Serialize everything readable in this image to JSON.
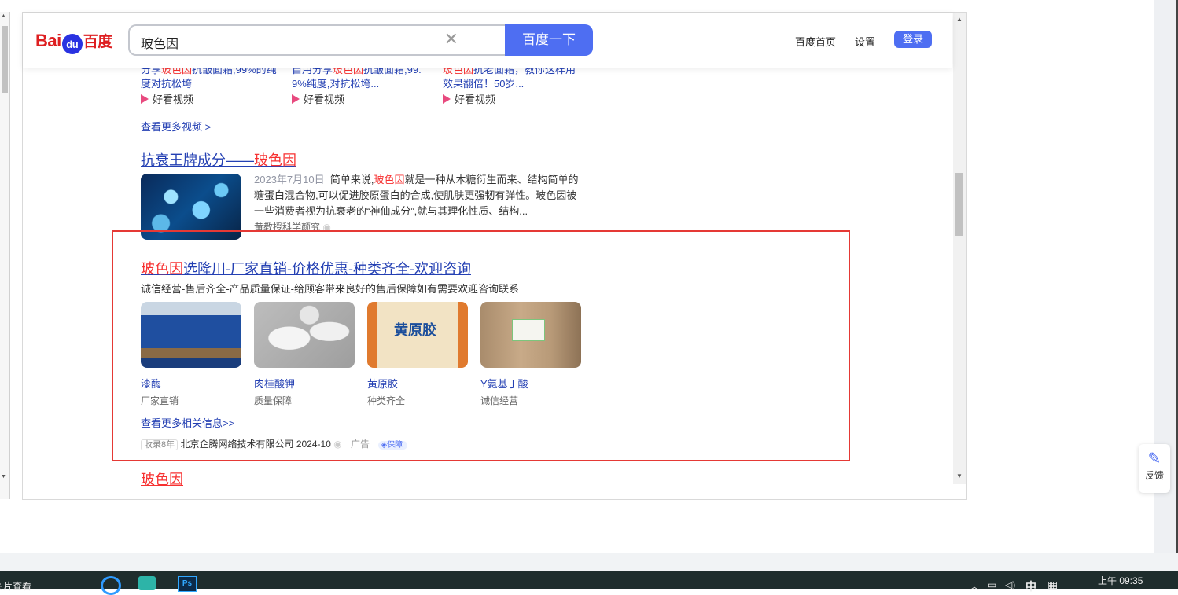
{
  "header": {
    "logo_latin": "Bai",
    "logo_paw": "du",
    "logo_cn": "百度",
    "query": "玻色因",
    "search_button": "百度一下",
    "nav_home": "百度首页",
    "nav_settings": "设置",
    "login": "登录"
  },
  "videos": [
    {
      "pre": "分享",
      "hl": "玻色因",
      "post": "抗皱面霜,99%的纯",
      "line2": "度对抗松垮",
      "source": "好看视频"
    },
    {
      "pre": "自用分享",
      "hl": "玻色因",
      "post": "抗皱面霜,99.",
      "line2": "9%纯度,对抗松垮...",
      "source": "好看视频"
    },
    {
      "pre": "",
      "hl": "玻色因",
      "post": "抗老面霜，教你这样用",
      "line2": "效果翻倍！50岁...",
      "source": "好看视频"
    }
  ],
  "more_videos": "查看更多视频 >",
  "result1": {
    "title_pre": "抗衰王牌成分——",
    "title_hl": "玻色因",
    "date": "2023年7月10日",
    "snippet_pre": "简单来说,",
    "snippet_hl": "玻色因",
    "snippet_post": "就是一种从木糖衍生而来、结构简单的",
    "snippet_line2": "糖蛋白混合物,可以促进胶原蛋白的合成,使肌肤更强韧有弹性。玻色因被",
    "snippet_line3": "一些消费者视为抗衰老的“神仙成分”,就与其理化性质、结构...",
    "source": "黄教授科学颜究"
  },
  "ad": {
    "title_hl": "玻色因",
    "title_rest": "选隆川-厂家直销-价格优惠-种类齐全-欢迎咨询",
    "desc": "诚信经营-售后齐全-产品质量保证-给顾客带来良好的售后保障如有需要欢迎咨询联系",
    "products": [
      {
        "name": "漆酶",
        "desc": "厂家直销"
      },
      {
        "name": "肉桂酸钾",
        "desc": "质量保障"
      },
      {
        "name": "黄原胶",
        "desc": "种类齐全"
      },
      {
        "name": "Y氨基丁酸",
        "desc": "诚信经营"
      }
    ],
    "product_image_text": "黄原胶",
    "more": "查看更多相关信息>>",
    "tag": "收录8年",
    "company": "北京企腾网络技术有限公司",
    "date": "2024-10",
    "ad_label": "广告",
    "badge": "保障"
  },
  "next_title": "玻色因",
  "feedback": "反馈",
  "taskbar": {
    "left_text": "图片查看",
    "ime": "中",
    "time": "上午 09:35"
  }
}
